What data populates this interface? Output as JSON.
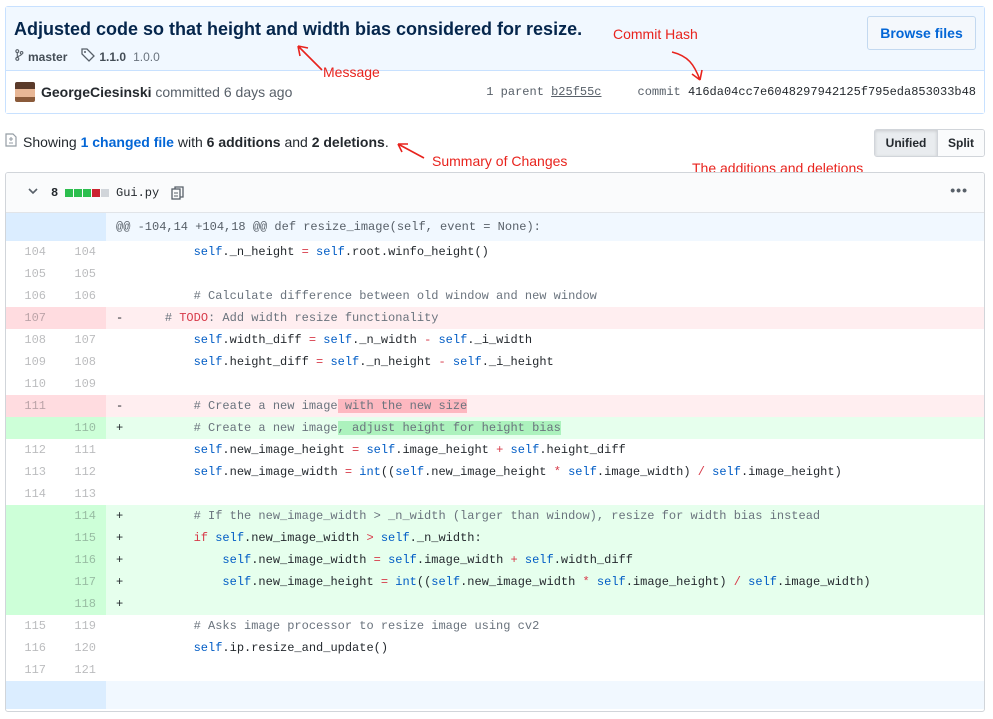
{
  "commit": {
    "title": "Adjusted code so that height and width bias considered for resize.",
    "branch": "master",
    "tag_primary": "1.1.0",
    "tag_secondary": "1.0.0",
    "browse_label": "Browse files",
    "author": "GeorgeCiesinski",
    "action": "committed 6 days ago",
    "parent_label": "1 parent",
    "parent_sha": "b25f55c",
    "commit_label": "commit",
    "sha": "416da04cc7e6048297942125f795eda853033b48"
  },
  "annotations": {
    "message": "Message",
    "hash": "Commit Hash",
    "summary": "Summary of Changes",
    "additions": "The additions and deletions"
  },
  "summary": {
    "showing": "Showing",
    "changed": "1 changed file",
    "with": "with",
    "additions": "6 additions",
    "and": "and",
    "deletions": "2 deletions",
    "period": "."
  },
  "view": {
    "unified": "Unified",
    "split": "Split"
  },
  "file": {
    "count": "8",
    "name": "Gui.py",
    "more": "•••",
    "diffstat": [
      "add",
      "add",
      "add",
      "del",
      "neutral"
    ]
  },
  "diff": {
    "hunk_header": "@@ -104,14 +104,18 @@ def resize_image(self, event = None):",
    "expand_icon": "expand-icon",
    "lines": [
      {
        "type": "ctx",
        "old": "104",
        "new": "104",
        "marker": "",
        "code": "        self._n_height = self.root.winfo_height()"
      },
      {
        "type": "ctx",
        "old": "105",
        "new": "105",
        "marker": "",
        "code": ""
      },
      {
        "type": "ctx",
        "old": "106",
        "new": "106",
        "marker": "",
        "code": "        # Calculate difference between old window and new window"
      },
      {
        "type": "del",
        "old": "107",
        "new": "",
        "marker": "-",
        "code": "    # TODO: Add width resize functionality"
      },
      {
        "type": "ctx",
        "old": "108",
        "new": "107",
        "marker": "",
        "code": "        self.width_diff = self._n_width - self._i_width"
      },
      {
        "type": "ctx",
        "old": "109",
        "new": "108",
        "marker": "",
        "code": "        self.height_diff = self._n_height - self._i_height"
      },
      {
        "type": "ctx",
        "old": "110",
        "new": "109",
        "marker": "",
        "code": ""
      },
      {
        "type": "del",
        "old": "111",
        "new": "",
        "marker": "-",
        "code": "        # Create a new image",
        "hl": " with the new size"
      },
      {
        "type": "add",
        "old": "",
        "new": "110",
        "marker": "+",
        "code": "        # Create a new image",
        "hl": ", adjust height for height bias"
      },
      {
        "type": "ctx",
        "old": "112",
        "new": "111",
        "marker": "",
        "code": "        self.new_image_height = self.image_height + self.height_diff"
      },
      {
        "type": "ctx",
        "old": "113",
        "new": "112",
        "marker": "",
        "code": "        self.new_image_width = int((self.new_image_height * self.image_width) / self.image_height)"
      },
      {
        "type": "ctx",
        "old": "114",
        "new": "113",
        "marker": "",
        "code": ""
      },
      {
        "type": "add",
        "old": "",
        "new": "114",
        "marker": "+",
        "code": "        # If the new_image_width > _n_width (larger than window), resize for width bias instead"
      },
      {
        "type": "add",
        "old": "",
        "new": "115",
        "marker": "+",
        "code": "        if self.new_image_width > self._n_width:"
      },
      {
        "type": "add",
        "old": "",
        "new": "116",
        "marker": "+",
        "code": "            self.new_image_width = self.image_width + self.width_diff"
      },
      {
        "type": "add",
        "old": "",
        "new": "117",
        "marker": "+",
        "code": "            self.new_image_height = int((self.new_image_width * self.image_height) / self.image_width)"
      },
      {
        "type": "add",
        "old": "",
        "new": "118",
        "marker": "+",
        "code": ""
      },
      {
        "type": "ctx",
        "old": "115",
        "new": "119",
        "marker": "",
        "code": "        # Asks image processor to resize image using cv2"
      },
      {
        "type": "ctx",
        "old": "116",
        "new": "120",
        "marker": "",
        "code": "        self.ip.resize_and_update()"
      },
      {
        "type": "ctx",
        "old": "117",
        "new": "121",
        "marker": "",
        "code": ""
      }
    ]
  },
  "colors": {
    "title": "#05264c",
    "link": "#0366d6",
    "annotation": "#e8231d",
    "add_bg": "#e6ffed",
    "del_bg": "#ffeef0",
    "diffstat_add": "#2cbe4e",
    "diffstat_del": "#cb2431",
    "diffstat_neutral": "#d1d5da"
  }
}
